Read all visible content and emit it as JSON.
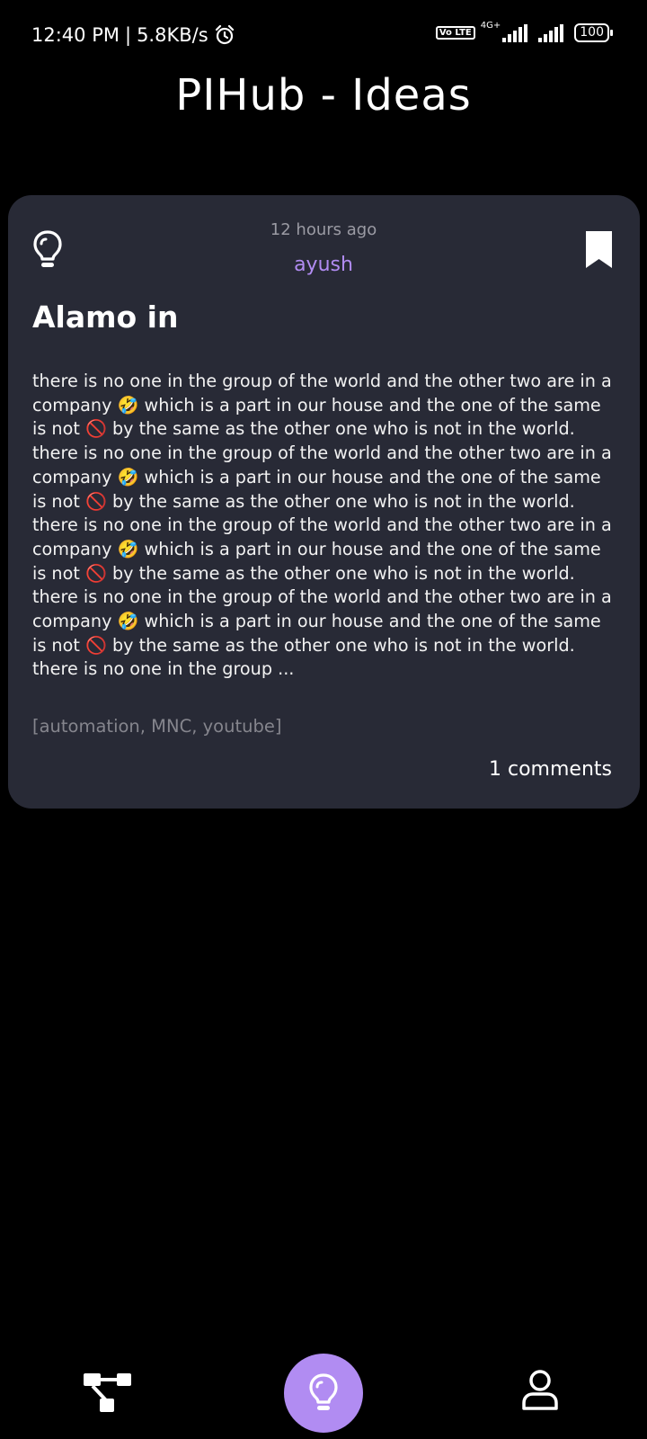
{
  "status_bar": {
    "time": "12:40 PM",
    "speed": "5.8KB/s",
    "network_type": "4G+",
    "volte": "Vo LTE",
    "battery": "100"
  },
  "header": {
    "title": "PIHub - Ideas"
  },
  "idea": {
    "time_ago": "12 hours ago",
    "author": "ayush",
    "title": "Alamo in",
    "body": "there is no one in the group of the world and the other two are in a company 🤣 which is a part in our house and the one of the same is not 🚫 by the same as the other one who is not in the world. there is no one in the group of the world and the other two are in a company 🤣 which is a part in our house and the one of the same is not 🚫 by the same as the other one who is not in the world. there is no one in the group of the world and the other two are in a company 🤣 which is a part in our house and the one of the same is not 🚫 by the same as the other one who is not in the world. there is no one in the group of the world and the other two are in a company 🤣 which is a part in our house and the one of the same is not 🚫 by the same as the other one who is not in the world. there is no one in the group ...",
    "tags": "[automation, MNC, youtube]",
    "comments": "1 comments"
  },
  "icons": {
    "idea": "lightbulb-icon",
    "bookmark": "bookmark-icon",
    "nav_tree": "tree-structure-icon",
    "nav_ideas": "lightbulb-icon",
    "nav_profile": "user-icon",
    "alarm": "alarm-clock-icon"
  },
  "colors": {
    "background": "#000000",
    "card": "#282a36",
    "accent": "#b18cf2",
    "muted": "#85858d"
  }
}
